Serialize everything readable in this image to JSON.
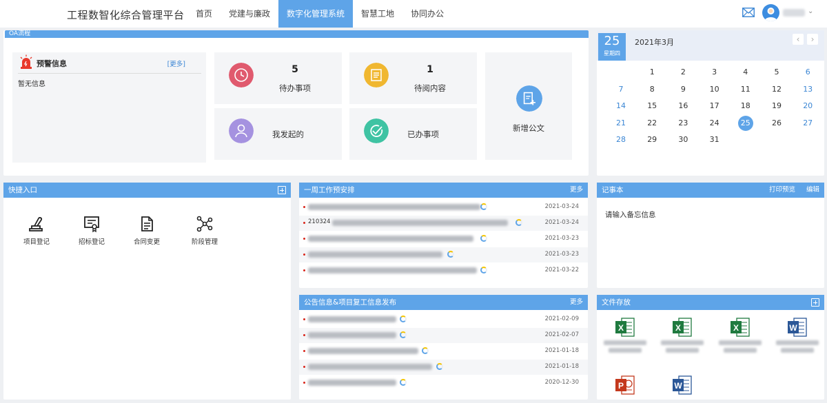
{
  "header": {
    "title": "工程数智化综合管理平台",
    "nav": [
      "首页",
      "党建与廉政",
      "数字化管理系统",
      "智慧工地",
      "协同办公"
    ],
    "active_nav": "数字化管理系统",
    "icons": [
      "mail-icon",
      "avatar",
      "chevron-down-icon"
    ]
  },
  "oa": {
    "label": "OA流程",
    "warning": {
      "title": "预警信息",
      "more": "[更多]",
      "empty": "暂无信息"
    },
    "cards": [
      {
        "count": "5",
        "label": "待办事项",
        "color": "#e05a6e"
      },
      {
        "count": "1",
        "label": "待阅内容",
        "color": "#f0b730"
      },
      {
        "count": "",
        "label": "我发起的",
        "color": "#a592e0"
      },
      {
        "count": "",
        "label": "已办事项",
        "color": "#3fc3a3"
      },
      {
        "count": "",
        "label": "新增公文",
        "color": "#5ea4e8"
      }
    ]
  },
  "calendar": {
    "day": "25",
    "weekday": "星期四",
    "month_title": "2021年3月",
    "days": [
      "1",
      "2",
      "3",
      "4",
      "5",
      "6",
      "7",
      "8",
      "9",
      "10",
      "11",
      "12",
      "13",
      "14",
      "15",
      "16",
      "17",
      "18",
      "19",
      "20",
      "21",
      "22",
      "23",
      "24",
      "25",
      "26",
      "27",
      "28",
      "29",
      "30",
      "31"
    ],
    "selected": "25"
  },
  "quick": {
    "title": "快捷入口",
    "items": [
      "项目登记",
      "招标登记",
      "合同变更",
      "阶段管理"
    ]
  },
  "week": {
    "title": "一周工作预安排",
    "more": "更多",
    "dates": [
      "2021-03-24",
      "2021-03-24",
      "2021-03-23",
      "2021-03-23",
      "2021-03-22"
    ],
    "row1_prefix": "210324"
  },
  "notice": {
    "title": "公告信息&项目复工信息发布",
    "more": "更多",
    "dates": [
      "2021-02-09",
      "2021-02-07",
      "2021-01-18",
      "2021-01-18",
      "2020-12-30"
    ]
  },
  "memo": {
    "title": "记事本",
    "print": "打印预览",
    "edit": "编辑",
    "placeholder": "请输入备忘信息"
  },
  "files": {
    "title": "文件存放",
    "items": [
      {
        "type": "excel-icon"
      },
      {
        "type": "excel-icon"
      },
      {
        "type": "excel-icon"
      },
      {
        "type": "word-icon"
      },
      {
        "type": "ppt-icon"
      },
      {
        "type": "word-icon"
      }
    ]
  }
}
